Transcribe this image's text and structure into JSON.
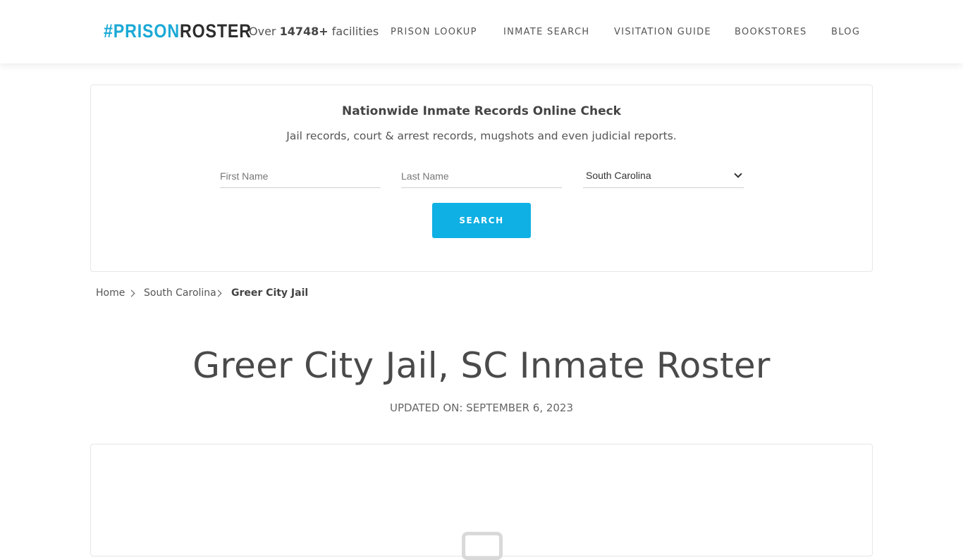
{
  "header": {
    "logo_part1": "#PRISON",
    "logo_part2": "ROSTER",
    "facilities_prefix": "Over",
    "facilities_count": "14748+",
    "facilities_suffix": "facilities",
    "nav": [
      {
        "label": "PRISON LOOKUP"
      },
      {
        "label": "INMATE SEARCH"
      },
      {
        "label": "VISITATION GUIDE"
      },
      {
        "label": "BOOKSTORES"
      },
      {
        "label": "BLOG"
      }
    ]
  },
  "search": {
    "title": "Nationwide Inmate Records Online Check",
    "subtitle": "Jail records, court & arrest records, mugshots and even judicial reports.",
    "first_name_placeholder": "First Name",
    "last_name_placeholder": "Last Name",
    "state_selected": "South Carolina",
    "button_label": "SEARCH"
  },
  "breadcrumb": {
    "home": "Home",
    "state": "South Carolina",
    "current": "Greer City Jail"
  },
  "page": {
    "title": "Greer City Jail, SC Inmate Roster",
    "updated": "UPDATED ON: SEPTEMBER 6, 2023"
  },
  "colors": {
    "accent": "#0fb0e3",
    "logo_blue": "#1ba9d6",
    "text": "#4a4a4a"
  }
}
